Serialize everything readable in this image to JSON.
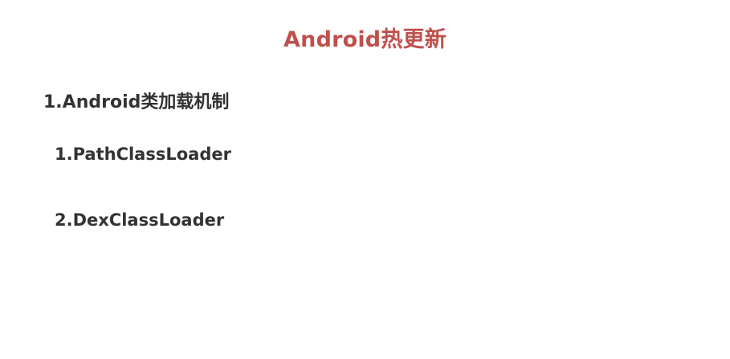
{
  "slide": {
    "title": "Android热更新",
    "heading": "1.Android类加载机制",
    "items": [
      "1.PathClassLoader",
      "2.DexClassLoader"
    ],
    "colors": {
      "title": "#c0504d",
      "text": "#333333",
      "background": "#ffffff"
    }
  }
}
